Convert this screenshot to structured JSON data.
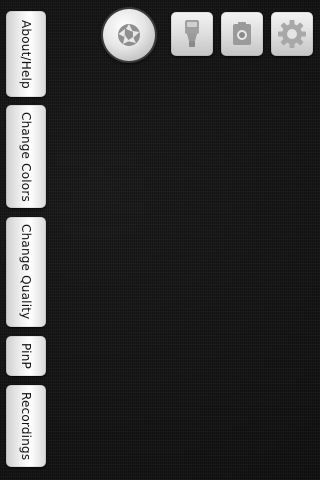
{
  "menu": {
    "about_help": "About/Help",
    "change_colors": "Change Colors",
    "change_quality": "Change Quality",
    "pinp": "PinP",
    "recordings": "Recordings"
  },
  "toolbar": {
    "shutter_icon": "aperture-icon",
    "flash_icon": "flashlight-icon",
    "camera_icon": "camera-icon",
    "settings_icon": "gear-icon"
  },
  "colors": {
    "background": "#161616",
    "button_face": "#f0f0f0",
    "icon_gray": "#9a9a9a"
  }
}
